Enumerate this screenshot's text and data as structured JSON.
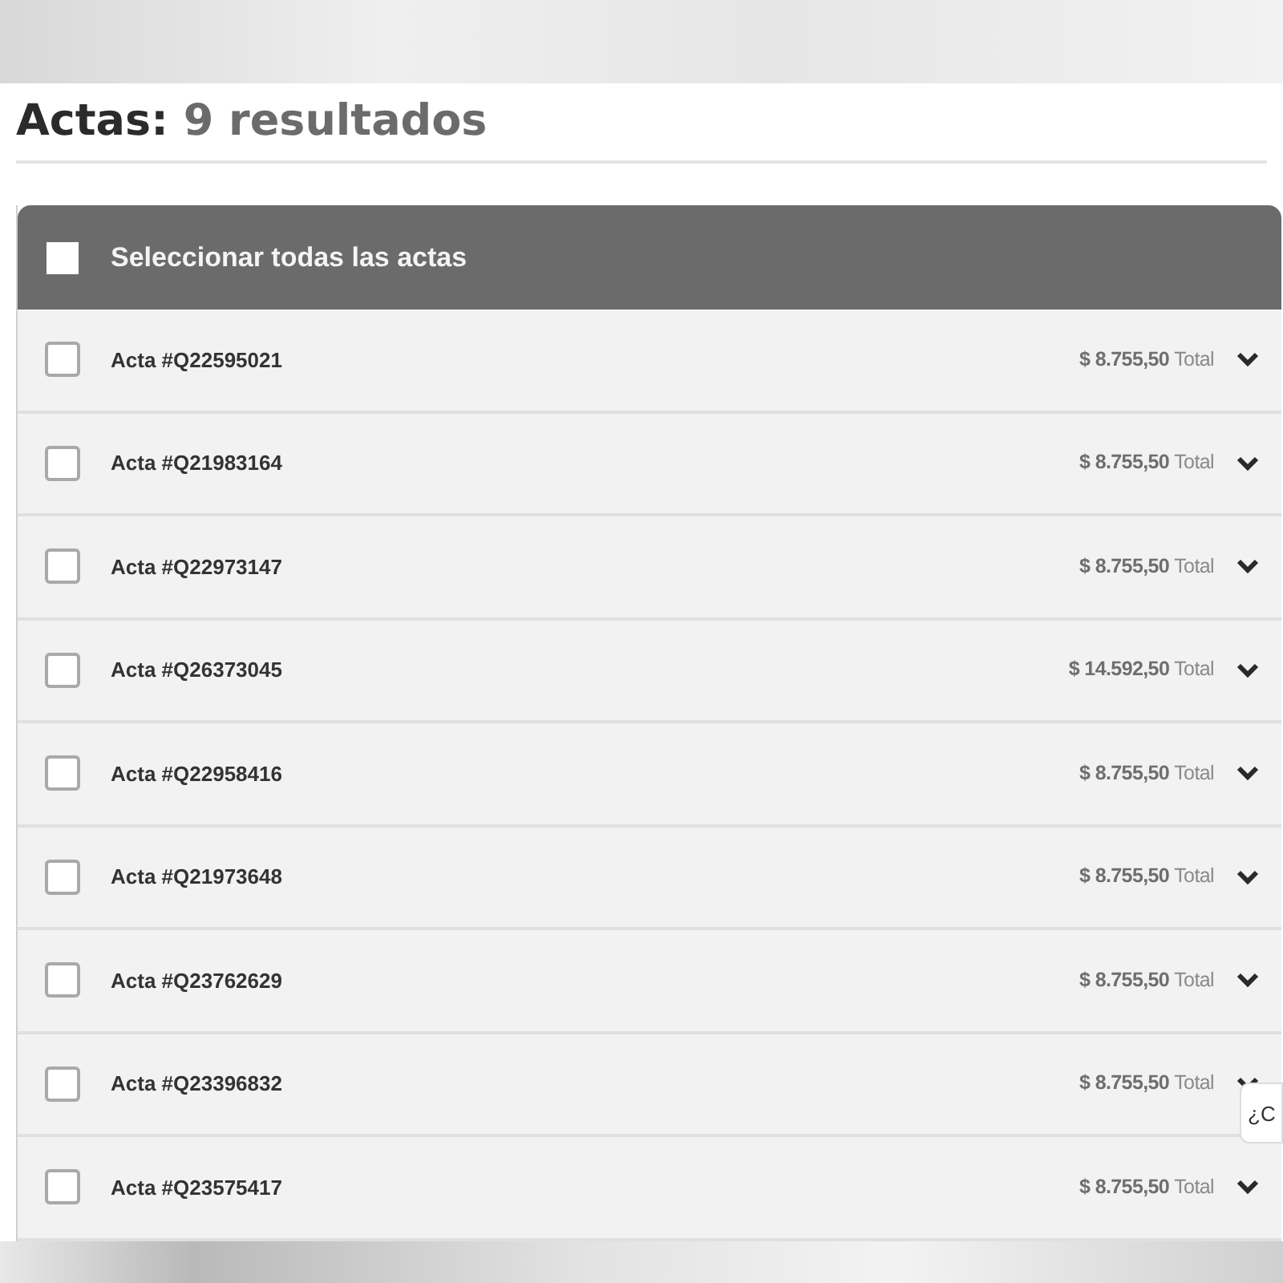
{
  "heading": {
    "label": "Actas:",
    "count": "9 resultados"
  },
  "select_all": {
    "label": "Seleccionar todas las actas",
    "checked": false
  },
  "actas": [
    {
      "title": "Acta #Q22595021",
      "amount": "$ 8.755,50",
      "total_label": "Total",
      "checked": false
    },
    {
      "title": "Acta #Q21983164",
      "amount": "$ 8.755,50",
      "total_label": "Total",
      "checked": false
    },
    {
      "title": "Acta #Q22973147",
      "amount": "$ 8.755,50",
      "total_label": "Total",
      "checked": false
    },
    {
      "title": "Acta #Q26373045",
      "amount": "$ 14.592,50",
      "total_label": "Total",
      "checked": false
    },
    {
      "title": "Acta #Q22958416",
      "amount": "$ 8.755,50",
      "total_label": "Total",
      "checked": false
    },
    {
      "title": "Acta #Q21973648",
      "amount": "$ 8.755,50",
      "total_label": "Total",
      "checked": false
    },
    {
      "title": "Acta #Q23762629",
      "amount": "$ 8.755,50",
      "total_label": "Total",
      "checked": false
    },
    {
      "title": "Acta #Q23396832",
      "amount": "$ 8.755,50",
      "total_label": "Total",
      "checked": false
    },
    {
      "title": "Acta #Q23575417",
      "amount": "$ 8.755,50",
      "total_label": "Total",
      "checked": false
    }
  ],
  "chat_tab": {
    "label": "¿C"
  }
}
